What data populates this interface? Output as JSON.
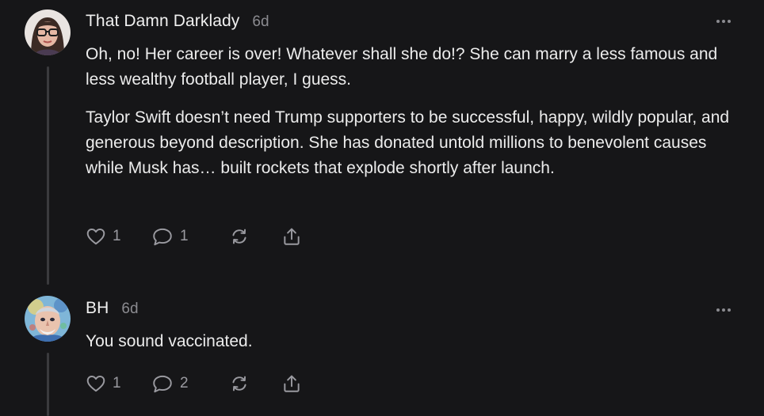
{
  "comments": [
    {
      "author": "That Damn Darklady",
      "time": "6d",
      "avatar_icon": "woman-with-glasses-avatar",
      "paragraphs": [
        "Oh, no! Her career is over! Whatever shall she do!? She can marry a less famous and less wealthy football player, I guess.",
        "Taylor Swift doesn’t need Trump supporters to be successful, happy, wildly popular, and generous beyond description. She has donated untold millions to benevolent causes while Musk has… built rockets that explode shortly after launch."
      ],
      "likes": "1",
      "replies": "1",
      "actions": {
        "like_icon": "heart-icon",
        "reply_icon": "comment-icon",
        "restack_icon": "restack-icon",
        "share_icon": "share-icon"
      }
    },
    {
      "author": "BH",
      "time": "6d",
      "avatar_icon": "painted-face-avatar",
      "paragraphs": [
        "You sound vaccinated."
      ],
      "likes": "1",
      "replies": "2",
      "actions": {
        "like_icon": "heart-icon",
        "reply_icon": "comment-icon",
        "restack_icon": "restack-icon",
        "share_icon": "share-icon"
      }
    }
  ],
  "colors": {
    "background": "#161618",
    "text": "#ececec",
    "muted": "#8b8b90",
    "thread_line": "#3a3a3d"
  }
}
